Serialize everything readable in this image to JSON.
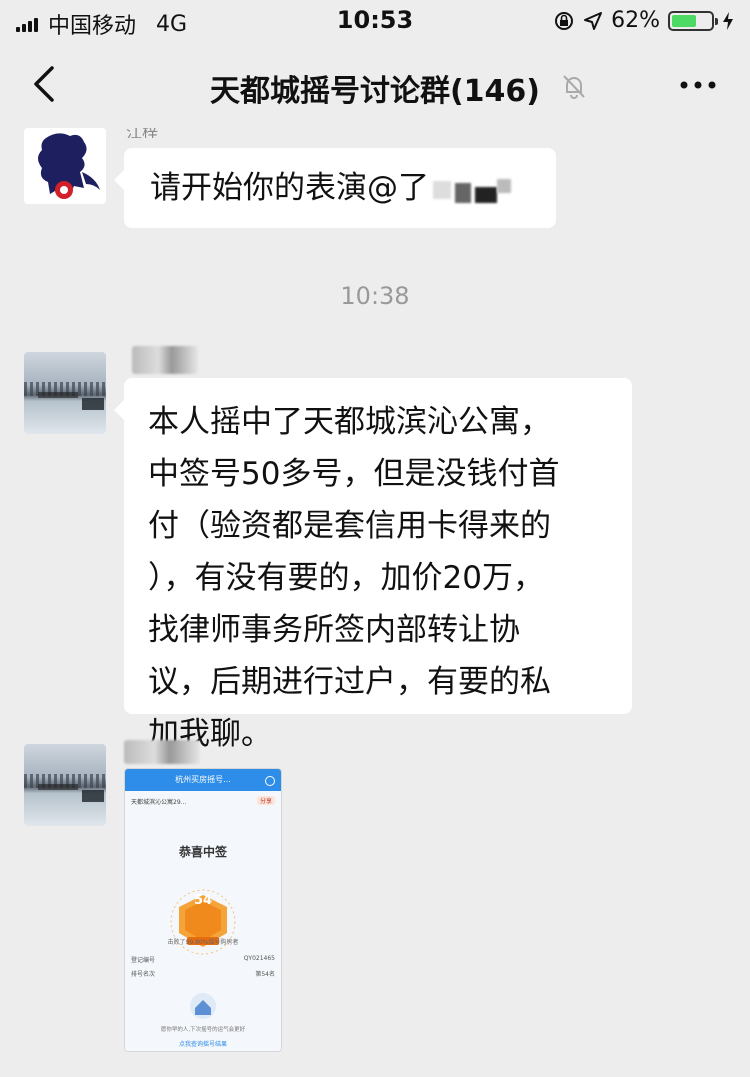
{
  "status_bar": {
    "carrier": "中国移动",
    "network": "4G",
    "time": "10:53",
    "battery_percent": "62%",
    "battery_level": 0.62
  },
  "nav": {
    "title": "天都城摇号讨论群(146)",
    "back_icon": "chevron-left-icon",
    "mute_icon": "bell-muted-icon",
    "more_icon": "ellipsis-icon"
  },
  "messages": [
    {
      "sender_name": "江梓",
      "avatar": "lion-logo",
      "text": "请开始你的表演@了"
    },
    {
      "time_divider": "10:38"
    },
    {
      "avatar": "lake-photo",
      "text": "本人摇中了天都城滨沁公寓，中签号50多号，但是没钱付首付（验资都是套信用卡得来的），有没有要的，加价20万，找律师事务所签内部转让协议，后期进行过户，有要的私加我聊。",
      "lines": [
        "本人摇中了天都城滨沁公寓，",
        "中签号50多号，但是没钱付首",
        "付（验资都是套信用卡得来的",
        "），有没有要的，加价20万，",
        "找律师事务所签内部转让协",
        "议，后期进行过户，有要的私",
        "加我聊。"
      ]
    },
    {
      "avatar": "lake-photo",
      "image": {
        "header": "杭州买房摇号...",
        "subtitle": "天都城滨沁公寓29...",
        "tag": "分享",
        "heading": "恭喜中签",
        "number": "54",
        "beat_text": "击败了99.80%摇号购房者",
        "rows": [
          {
            "label": "登记编号",
            "value": "QY021465"
          },
          {
            "label": "排号名次",
            "value": "第54名"
          }
        ],
        "footer_text": "愿你早的人,下次摇号的运气会更好",
        "link_text": "点我查询摇号结果"
      }
    }
  ],
  "colors": {
    "background": "#ededed",
    "bubble": "#ffffff",
    "battery_fill": "#4cd964",
    "card_header": "#2e8de8"
  }
}
